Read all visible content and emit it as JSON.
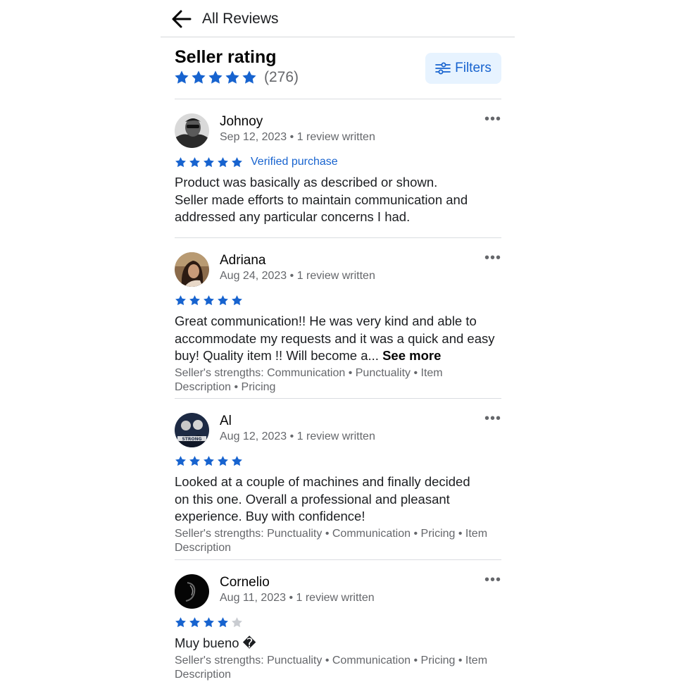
{
  "header": {
    "title": "All Reviews"
  },
  "seller": {
    "title": "Seller rating",
    "rating": 5,
    "count": "(276)",
    "filters_label": "Filters"
  },
  "colors": {
    "accent": "#1763cf",
    "star_filled": "#1763cf",
    "star_empty": "#c9ccd1",
    "button_bg": "#e7f3ff"
  },
  "reviews": [
    {
      "name": "Johnoy",
      "meta": "Sep 12, 2023 • 1 review written",
      "stars": 5,
      "badge": "Verified purchase",
      "lines": [
        "Product was basically as described or shown.",
        "Seller made efforts to maintain communication and",
        "addressed any particular concerns I had."
      ]
    },
    {
      "name": "Adriana",
      "meta": "Aug 24, 2023 • 1 review written",
      "stars": 5,
      "lines": [
        "Great communication!! He was very kind and able to",
        "accommodate my requests and it was a quick and easy",
        "buy! Quality item !! Will become a..."
      ],
      "see_more": "See more",
      "strengths": [
        "Seller's strengths: Communication • Punctuality • Item",
        "Description • Pricing"
      ]
    },
    {
      "name": "Al",
      "meta": "Aug 12, 2023 • 1 review written",
      "stars": 5,
      "lines": [
        "Looked at a couple of machines and finally decided",
        "on this one. Overall a professional and pleasant",
        "experience. Buy with confidence!"
      ],
      "strengths": [
        "Seller's strengths: Punctuality • Communication • Pricing • Item",
        "Description"
      ]
    },
    {
      "name": "Cornelio",
      "meta": "Aug 11, 2023 • 1 review written",
      "stars": 4,
      "lines": [
        "Muy bueno �"
      ],
      "strengths": [
        "Seller's strengths: Punctuality • Communication • Pricing • Item",
        "Description"
      ]
    }
  ]
}
